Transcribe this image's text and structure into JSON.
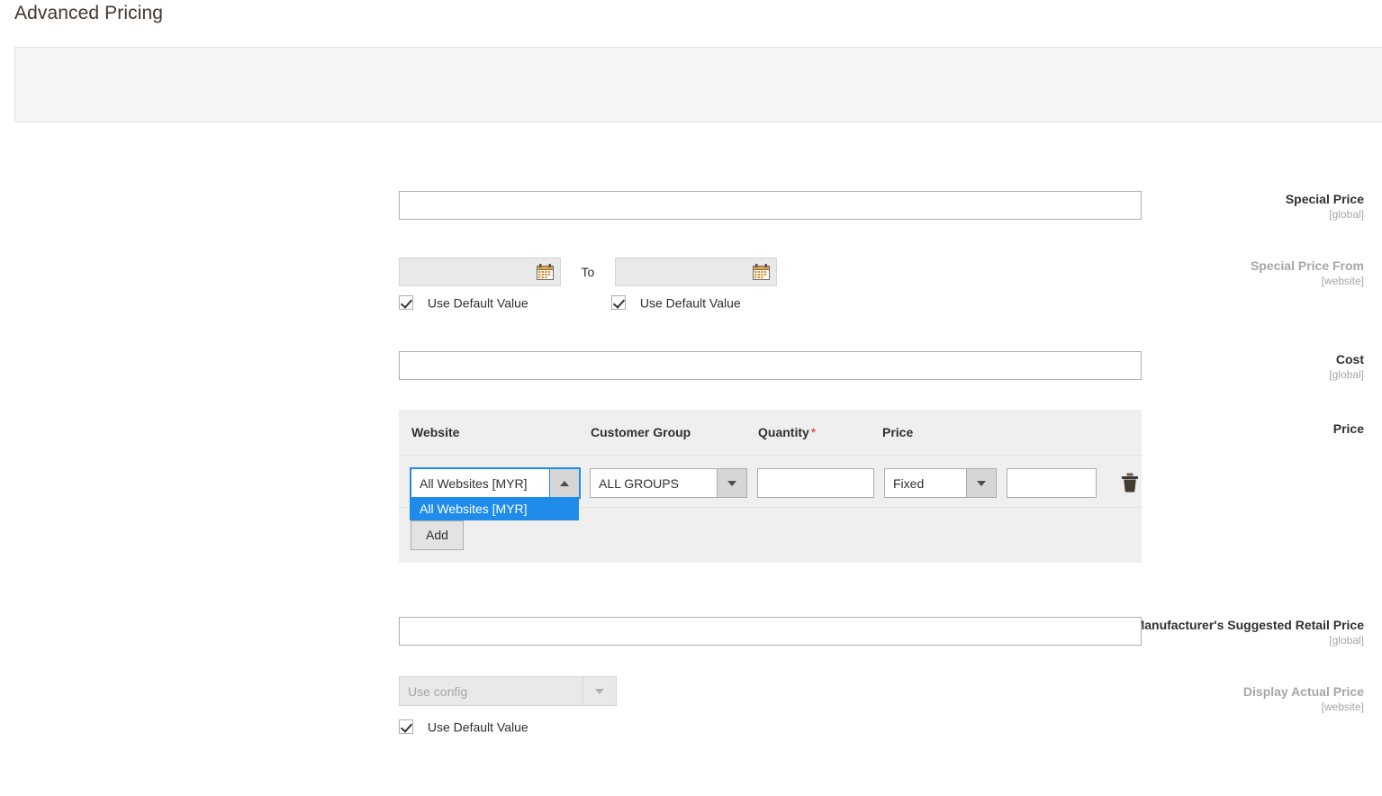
{
  "page": {
    "title": "Advanced Pricing"
  },
  "fields": {
    "special_price": {
      "label": "Special Price",
      "scope": "[global]",
      "value": "",
      "placeholder": ""
    },
    "special_price_from": {
      "label": "Special Price From",
      "scope": "[website]",
      "from_value": "",
      "to_label": "To",
      "to_value": "",
      "calendar_icon": "calendar-icon",
      "use_default_from": "Use Default Value",
      "use_default_to": "Use Default Value"
    },
    "cost": {
      "label": "Cost",
      "scope": "[global]",
      "value": ""
    },
    "price": {
      "label": "Price"
    },
    "msrp": {
      "label": "Manufacturer's Suggested Retail Price",
      "scope": "[global]",
      "value": ""
    },
    "display_actual_price": {
      "label": "Display Actual Price",
      "scope": "[website]",
      "value": "Use config",
      "use_default": "Use Default Value"
    }
  },
  "price_table": {
    "columns": [
      {
        "label": "Website",
        "required": false
      },
      {
        "label": "Customer Group",
        "required": true
      },
      {
        "label": "Quantity",
        "required": true
      },
      {
        "label": "Price",
        "required": false
      }
    ],
    "required_marker": "*",
    "rows": [
      {
        "website": "All Websites [MYR]",
        "website_open": true,
        "website_options": [
          "All Websites [MYR]"
        ],
        "website_selected_index": 0,
        "customer_group": "ALL GROUPS",
        "quantity": "",
        "price_type": "Fixed",
        "price_value": "",
        "delete_icon": "trash-icon"
      }
    ],
    "add_label": "Add"
  },
  "colors": {
    "accent_blue": "#1f8ceb",
    "required_red": "#e22626",
    "panel_gray": "#f5f5f5",
    "table_gray": "#efefef",
    "text_dark": "#303030",
    "text_muted": "#a6a6a6"
  }
}
